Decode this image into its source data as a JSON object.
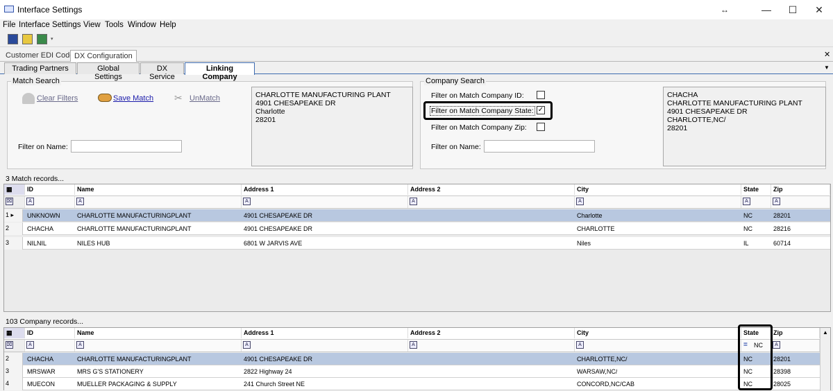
{
  "window": {
    "title": "Interface Settings",
    "resize_glyph": "↔",
    "minimize": "—",
    "maximize": "☐",
    "close": "✕"
  },
  "menu": [
    "File",
    "Interface Settings",
    "View",
    "Tools",
    "Window",
    "Help"
  ],
  "toolbar": {
    "icons": [
      "save-icon",
      "open-icon",
      "export-icon"
    ]
  },
  "outer_tabs": [
    "Customer EDI Codes",
    "DX Configuration"
  ],
  "inner_tabs": [
    "Trading Partners",
    "Global Settings",
    "DX Service",
    "Linking Company"
  ],
  "match_search": {
    "label": "Match Search",
    "clear_filters": "Clear Filters",
    "save_match": "Save Match",
    "unmatch": "UnMatch",
    "filter_name_label": "Filter on Name:",
    "filter_name_value": "",
    "address": "CHARLOTTE MANUFACTURING PLANT\n4901 CHESAPEAKE DR\nCharlotte\n28201"
  },
  "company_search": {
    "label": "Company Search",
    "filter_id_label": "Filter on Match Company ID:",
    "filter_id_checked": false,
    "filter_state_label": "Filter on Match Company State:",
    "filter_state_checked": true,
    "filter_zip_label": "Filter on Match Company Zip:",
    "filter_zip_checked": false,
    "filter_name_label": "Filter on Name:",
    "filter_name_value": "",
    "address": "CHACHA\nCHARLOTTE MANUFACTURING PLANT\n4901 CHESAPEAKE DR\nCHARLOTTE,NC/\n28201"
  },
  "match_records": {
    "caption": "3 Match records...",
    "columns": [
      "ID",
      "Name",
      "Address 1",
      "Address 2",
      "City",
      "State",
      "Zip"
    ],
    "rows": [
      {
        "num": "1",
        "id": "UNKNOWN",
        "name": "CHARLOTTE MANUFACTURINGPLANT",
        "addr1": "4901 CHESAPEAKE DR",
        "addr2": "",
        "city": "Charlotte",
        "state": "NC",
        "zip": "28201"
      },
      {
        "num": "2",
        "id": "CHACHA",
        "name": "CHARLOTTE MANUFACTURINGPLANT",
        "addr1": "4901 CHESAPEAKE DR",
        "addr2": "",
        "city": "CHARLOTTE",
        "state": "NC",
        "zip": "28216"
      },
      {
        "num": "3",
        "id": "NILNIL",
        "name": "NILES HUB",
        "addr1": "6801 W JARVIS AVE",
        "addr2": "",
        "city": "Niles",
        "state": "IL",
        "zip": "60714"
      }
    ]
  },
  "company_records": {
    "caption": "103 Company records...",
    "columns": [
      "ID",
      "Name",
      "Address 1",
      "Address 2",
      "City",
      "State",
      "Zip"
    ],
    "state_filter_value": "NC",
    "state_filter_operator": "=",
    "rows": [
      {
        "num": "2",
        "id": "CHACHA",
        "name": "CHARLOTTE MANUFACTURINGPLANT",
        "addr1": "4901 CHESAPEAKE DR",
        "addr2": "",
        "city": "CHARLOTTE,NC/",
        "state": "NC",
        "zip": "28201"
      },
      {
        "num": "3",
        "id": "MRSWAR",
        "name": "MRS G'S STATIONERY",
        "addr1": "2822 Highway 24",
        "addr2": "",
        "city": "WARSAW,NC/",
        "state": "NC",
        "zip": "28398"
      },
      {
        "num": "4",
        "id": "MUECON",
        "name": "MUELLER PACKAGING & SUPPLY",
        "addr1": "241 Church Street NE",
        "addr2": "",
        "city": "CONCORD,NC/CAB",
        "state": "NC",
        "zip": "28025"
      }
    ]
  },
  "colors": {
    "selected_row": "#b8c8e0",
    "tab_border": "#3d6bb0",
    "link": "#1a1aaa"
  }
}
